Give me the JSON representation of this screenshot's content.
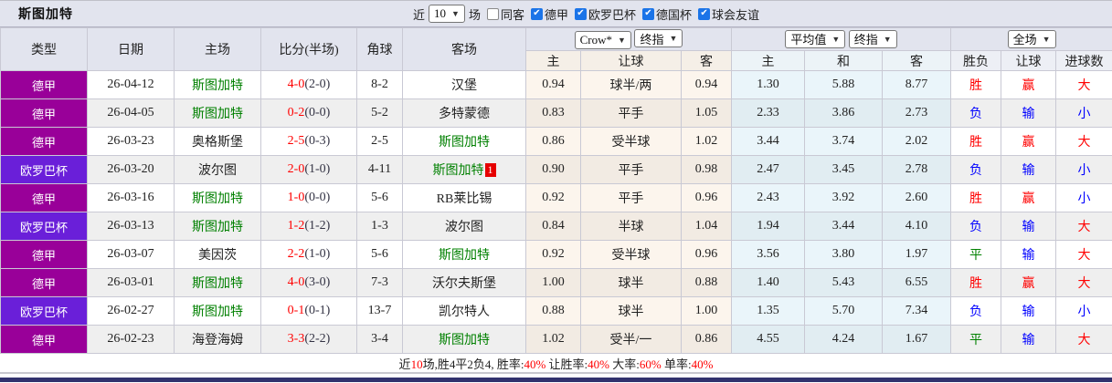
{
  "header": {
    "team_title": "斯图加特",
    "recent_label": "近",
    "recent_value": "10",
    "matches_label": "场",
    "filters": [
      {
        "label": "同客",
        "checked": false
      },
      {
        "label": "德甲",
        "checked": true
      },
      {
        "label": "欧罗巴杯",
        "checked": true
      },
      {
        "label": "德国杯",
        "checked": true
      },
      {
        "label": "球会友谊",
        "checked": true
      }
    ]
  },
  "dropdowns": {
    "ah_source": "Crow*",
    "ah_close": "终指",
    "eu_source": "平均值",
    "eu_close": "终指",
    "scope": "全场"
  },
  "columns": {
    "type": "类型",
    "date": "日期",
    "home": "主场",
    "score": "比分(半场)",
    "corners": "角球",
    "away": "客场",
    "ah_home": "主",
    "ah_line": "让球",
    "ah_away": "客",
    "eu_home": "主",
    "eu_draw": "和",
    "eu_away": "客",
    "res_wdl": "胜负",
    "res_ah": "让球",
    "res_ou": "进球数"
  },
  "rows": [
    {
      "league": "德甲",
      "date": "26-04-12",
      "home": "斯图加特",
      "home_main": true,
      "ft": "4-0",
      "ht": "2-0",
      "corners": "8-2",
      "away": "汉堡",
      "away_main": false,
      "away_badge": "",
      "ah_home": "0.94",
      "ah_line": "球半/两",
      "ah_away": "0.94",
      "eu_home": "1.30",
      "eu_draw": "5.88",
      "eu_away": "8.77",
      "res_wdl": "胜",
      "res_ah": "赢",
      "res_ou": "大"
    },
    {
      "league": "德甲",
      "date": "26-04-05",
      "home": "斯图加特",
      "home_main": true,
      "ft": "0-2",
      "ht": "0-0",
      "corners": "5-2",
      "away": "多特蒙德",
      "away_main": false,
      "away_badge": "",
      "ah_home": "0.83",
      "ah_line": "平手",
      "ah_away": "1.05",
      "eu_home": "2.33",
      "eu_draw": "3.86",
      "eu_away": "2.73",
      "res_wdl": "负",
      "res_ah": "输",
      "res_ou": "小"
    },
    {
      "league": "德甲",
      "date": "26-03-23",
      "home": "奥格斯堡",
      "home_main": false,
      "ft": "2-5",
      "ht": "0-3",
      "corners": "2-5",
      "away": "斯图加特",
      "away_main": true,
      "away_badge": "",
      "ah_home": "0.86",
      "ah_line": "受半球",
      "ah_away": "1.02",
      "eu_home": "3.44",
      "eu_draw": "3.74",
      "eu_away": "2.02",
      "res_wdl": "胜",
      "res_ah": "赢",
      "res_ou": "大"
    },
    {
      "league": "欧罗巴杯",
      "date": "26-03-20",
      "home": "波尔图",
      "home_main": false,
      "ft": "2-0",
      "ht": "1-0",
      "corners": "4-11",
      "away": "斯图加特",
      "away_main": true,
      "away_badge": "1",
      "ah_home": "0.90",
      "ah_line": "平手",
      "ah_away": "0.98",
      "eu_home": "2.47",
      "eu_draw": "3.45",
      "eu_away": "2.78",
      "res_wdl": "负",
      "res_ah": "输",
      "res_ou": "小"
    },
    {
      "league": "德甲",
      "date": "26-03-16",
      "home": "斯图加特",
      "home_main": true,
      "ft": "1-0",
      "ht": "0-0",
      "corners": "5-6",
      "away": "RB莱比锡",
      "away_main": false,
      "away_badge": "",
      "ah_home": "0.92",
      "ah_line": "平手",
      "ah_away": "0.96",
      "eu_home": "2.43",
      "eu_draw": "3.92",
      "eu_away": "2.60",
      "res_wdl": "胜",
      "res_ah": "赢",
      "res_ou": "小"
    },
    {
      "league": "欧罗巴杯",
      "date": "26-03-13",
      "home": "斯图加特",
      "home_main": true,
      "ft": "1-2",
      "ht": "1-2",
      "corners": "1-3",
      "away": "波尔图",
      "away_main": false,
      "away_badge": "",
      "ah_home": "0.84",
      "ah_line": "半球",
      "ah_away": "1.04",
      "eu_home": "1.94",
      "eu_draw": "3.44",
      "eu_away": "4.10",
      "res_wdl": "负",
      "res_ah": "输",
      "res_ou": "大"
    },
    {
      "league": "德甲",
      "date": "26-03-07",
      "home": "美因茨",
      "home_main": false,
      "ft": "2-2",
      "ht": "1-0",
      "corners": "5-6",
      "away": "斯图加特",
      "away_main": true,
      "away_badge": "",
      "ah_home": "0.92",
      "ah_line": "受半球",
      "ah_away": "0.96",
      "eu_home": "3.56",
      "eu_draw": "3.80",
      "eu_away": "1.97",
      "res_wdl": "平",
      "res_ah": "输",
      "res_ou": "大"
    },
    {
      "league": "德甲",
      "date": "26-03-01",
      "home": "斯图加特",
      "home_main": true,
      "ft": "4-0",
      "ht": "3-0",
      "corners": "7-3",
      "away": "沃尔夫斯堡",
      "away_main": false,
      "away_badge": "",
      "ah_home": "1.00",
      "ah_line": "球半",
      "ah_away": "0.88",
      "eu_home": "1.40",
      "eu_draw": "5.43",
      "eu_away": "6.55",
      "res_wdl": "胜",
      "res_ah": "赢",
      "res_ou": "大"
    },
    {
      "league": "欧罗巴杯",
      "date": "26-02-27",
      "home": "斯图加特",
      "home_main": true,
      "ft": "0-1",
      "ht": "0-1",
      "corners": "13-7",
      "away": "凯尔特人",
      "away_main": false,
      "away_badge": "",
      "ah_home": "0.88",
      "ah_line": "球半",
      "ah_away": "1.00",
      "eu_home": "1.35",
      "eu_draw": "5.70",
      "eu_away": "7.34",
      "res_wdl": "负",
      "res_ah": "输",
      "res_ou": "小"
    },
    {
      "league": "德甲",
      "date": "26-02-23",
      "home": "海登海姆",
      "home_main": false,
      "ft": "3-3",
      "ht": "2-2",
      "corners": "3-4",
      "away": "斯图加特",
      "away_main": true,
      "away_badge": "",
      "ah_home": "1.02",
      "ah_line": "受半/一",
      "ah_away": "0.86",
      "eu_home": "4.55",
      "eu_draw": "4.24",
      "eu_away": "1.67",
      "res_wdl": "平",
      "res_ah": "输",
      "res_ou": "大"
    }
  ],
  "footer": {
    "segments": [
      {
        "text": "近",
        "red": false
      },
      {
        "text": "10",
        "red": true
      },
      {
        "text": "场,胜4平2负4, 胜率:",
        "red": false
      },
      {
        "text": "40%",
        "red": true
      },
      {
        "text": " 让胜率:",
        "red": false
      },
      {
        "text": "40%",
        "red": true
      },
      {
        "text": " 大率:",
        "red": false
      },
      {
        "text": "60%",
        "red": true
      },
      {
        "text": " 单率:",
        "red": false
      },
      {
        "text": "40%",
        "red": true
      }
    ]
  },
  "colors": {
    "league": {
      "德甲": "#990099",
      "欧罗巴杯": "#6a1fd9"
    },
    "result": {
      "胜": "#ff0000",
      "平": "#008000",
      "负": "#0000ff",
      "赢": "#ff0000",
      "输": "#0000ff",
      "大": "#ff0000",
      "小": "#0000ff"
    },
    "team_highlight": "#008000",
    "score_red": "#ff0000",
    "badge_red": "#e60000",
    "checkbox_blue": "#1b74e8",
    "bottom_bar": "#32326e"
  }
}
